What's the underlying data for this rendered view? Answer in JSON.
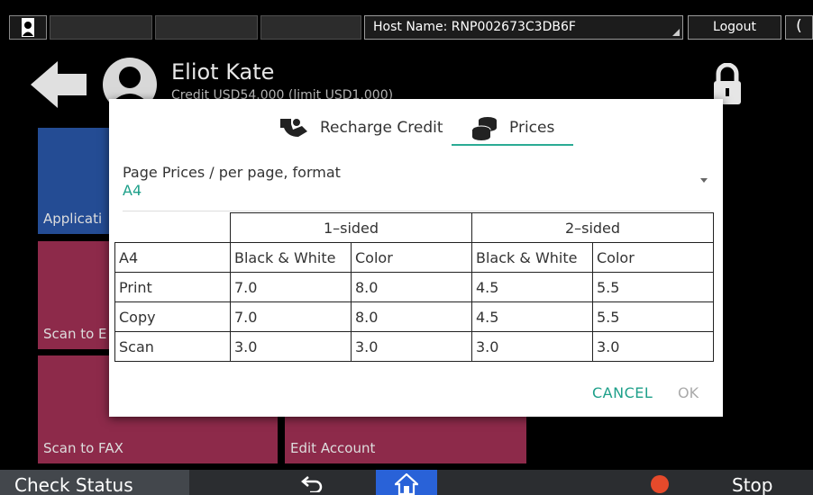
{
  "topbar": {
    "host_name": "Host Name: RNP002673C3DB6F",
    "logout_label": "Logout",
    "moon_glyph": "(",
    "user_icon": "user-icon"
  },
  "background": {
    "user_name": "Eliot Kate",
    "credit_text": "Credit USD54.000 (limit USD1.000)",
    "tiles": {
      "application": "Applicati",
      "scan_to_email": "Scan to E",
      "scan_to_fax": "Scan to FAX",
      "edit_account": "Edit Account"
    },
    "tile_colors": {
      "blue": "#244c94",
      "maroon": "#8d2a4a"
    }
  },
  "modal": {
    "tabs": {
      "recharge_label": "Recharge Credit",
      "prices_label": "Prices"
    },
    "format_label": "Page Prices / per page, format",
    "format_value": "A4",
    "accent_color": "#2bab94",
    "table": {
      "group_headers": [
        "1–sided",
        "2–sided"
      ],
      "format_cell": "A4",
      "column_headers": [
        "Black & White",
        "Color",
        "Black & White",
        "Color"
      ],
      "rows": [
        {
          "label": "Print",
          "values": [
            "7.0",
            "8.0",
            "4.5",
            "5.5"
          ]
        },
        {
          "label": "Copy",
          "values": [
            "7.0",
            "8.0",
            "4.5",
            "5.5"
          ]
        },
        {
          "label": "Scan",
          "values": [
            "3.0",
            "3.0",
            "3.0",
            "3.0"
          ]
        }
      ]
    },
    "cancel_label": "CANCEL",
    "ok_label": "OK"
  },
  "bottombar": {
    "check_status_label": "Check Status",
    "stop_label": "Stop"
  }
}
